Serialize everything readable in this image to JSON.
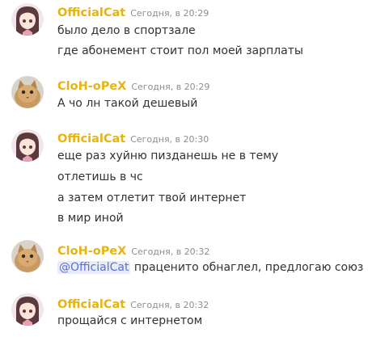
{
  "messages": [
    {
      "author": "OfficialCat",
      "timestamp": "Сегодня, в 20:29",
      "avatar": "anime-girl-avatar",
      "lines": [
        "было дело в спортзале",
        "где абонемент стоит пол моей зарплаты"
      ]
    },
    {
      "author": "CloH-oPeX",
      "timestamp": "Сегодня, в 20:29",
      "avatar": "cat-photo-avatar",
      "lines": [
        "А чо лн такой дешевый"
      ]
    },
    {
      "author": "OfficialCat",
      "timestamp": "Сегодня, в 20:30",
      "avatar": "anime-girl-avatar",
      "lines": [
        "еще раз хуйню пизданешь не в тему",
        "отлетишь в чс",
        "а затем отлетит твой интернет",
        "в мир иной"
      ]
    },
    {
      "author": "CloH-oPeX",
      "timestamp": "Сегодня, в 20:32",
      "avatar": "cat-photo-avatar",
      "mention": "@OfficialCat",
      "lines": [
        " праценито обнаглел, предлогаю союз"
      ]
    },
    {
      "author": "OfficialCat",
      "timestamp": "Сегодня, в 20:32",
      "avatar": "anime-girl-avatar",
      "lines": [
        "прощайся с интернетом"
      ]
    }
  ],
  "colors": {
    "author": "#e6b311",
    "text": "#2e3338",
    "timestamp": "#8a8e94",
    "mention": "#5b6fd6",
    "mention_bg": "#e8ebfa",
    "background": "#ffffff"
  }
}
